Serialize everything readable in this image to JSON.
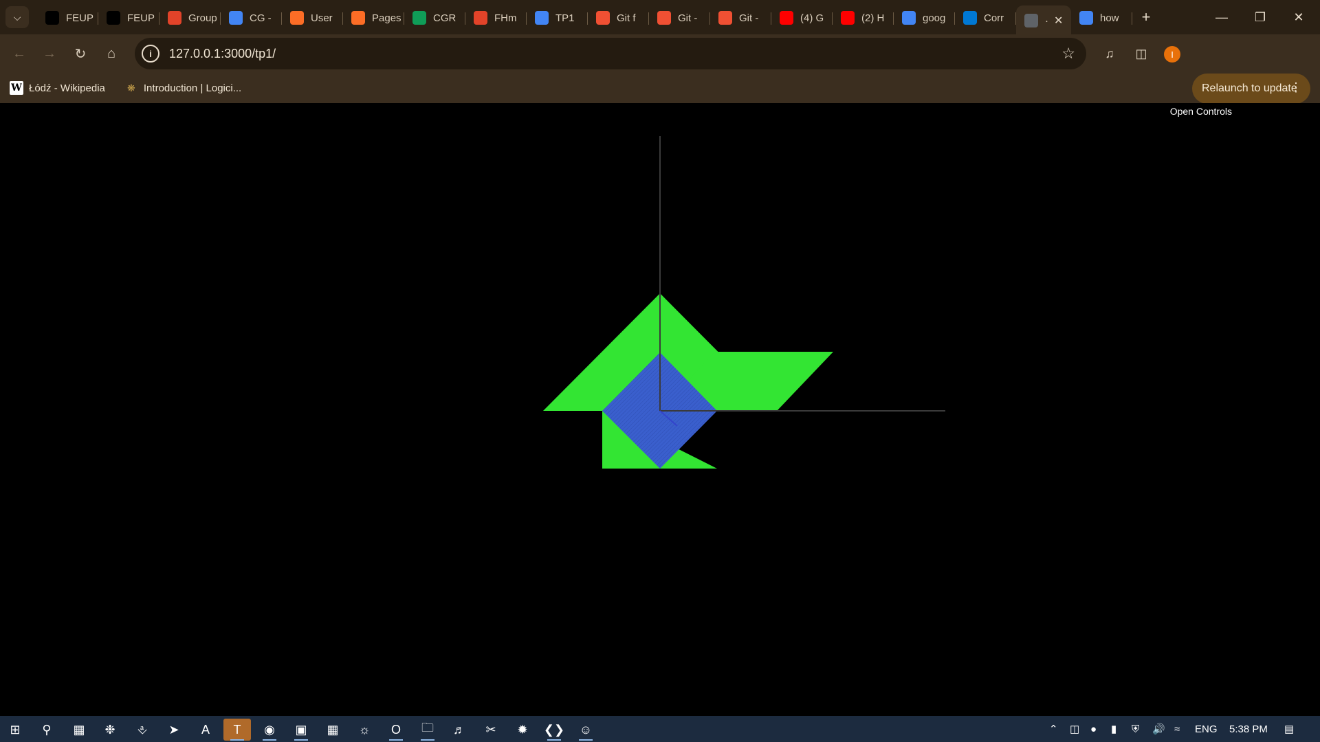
{
  "browser": {
    "tab_search_icon": "chevron-down-icon",
    "tabs": [
      {
        "title": "FEUP",
        "icon": "U.",
        "color": "#000000"
      },
      {
        "title": "FEUP",
        "icon": "U",
        "color": "#000000"
      },
      {
        "title": "Group",
        "icon": "gitlab",
        "color": "#e24329"
      },
      {
        "title": "CG -",
        "icon": "docs",
        "color": "#4285f4"
      },
      {
        "title": "User",
        "icon": "gitlab",
        "color": "#fc6d26"
      },
      {
        "title": "Pages",
        "icon": "gitlab",
        "color": "#fc6d26"
      },
      {
        "title": "CGR",
        "icon": "sheets",
        "color": "#0f9d58"
      },
      {
        "title": "FHm",
        "icon": "gitlab",
        "color": "#e24329"
      },
      {
        "title": "TP1",
        "icon": "docs",
        "color": "#4285f4"
      },
      {
        "title": "Git f",
        "icon": "git",
        "color": "#f05033"
      },
      {
        "title": "Git -",
        "icon": "git",
        "color": "#f05033"
      },
      {
        "title": "Git -",
        "icon": "git",
        "color": "#f05033"
      },
      {
        "title": "(4) G",
        "icon": "youtube",
        "color": "#ff0000"
      },
      {
        "title": "(2) H",
        "icon": "youtube",
        "color": "#ff0000"
      },
      {
        "title": "goog",
        "icon": "google",
        "color": "#4285f4"
      },
      {
        "title": "Corr",
        "icon": "outlook",
        "color": "#0078d4"
      },
      {
        "title": "·",
        "icon": "globe",
        "color": "#5f6368",
        "active": true
      },
      {
        "title": "how",
        "icon": "google",
        "color": "#4285f4"
      }
    ],
    "new_tab_label": "+",
    "url": "127.0.0.1:3000/tp1/",
    "relaunch_label": "Relaunch to update",
    "profile_initial": "I",
    "bookmarks": [
      {
        "label": "Łódź - Wikipedia",
        "icon": "wikipedia-icon"
      },
      {
        "label": "Introduction | Logici...",
        "icon": "logicismo-icon"
      }
    ]
  },
  "page": {
    "open_controls_label": "Open Controls",
    "scene_colors": {
      "green": "#33e533",
      "blue": "#3a5fcd",
      "axis": "#3a3a3a",
      "background": "#000000"
    }
  },
  "taskbar": {
    "tray_language": "ENG",
    "clock": "5:38 PM"
  }
}
